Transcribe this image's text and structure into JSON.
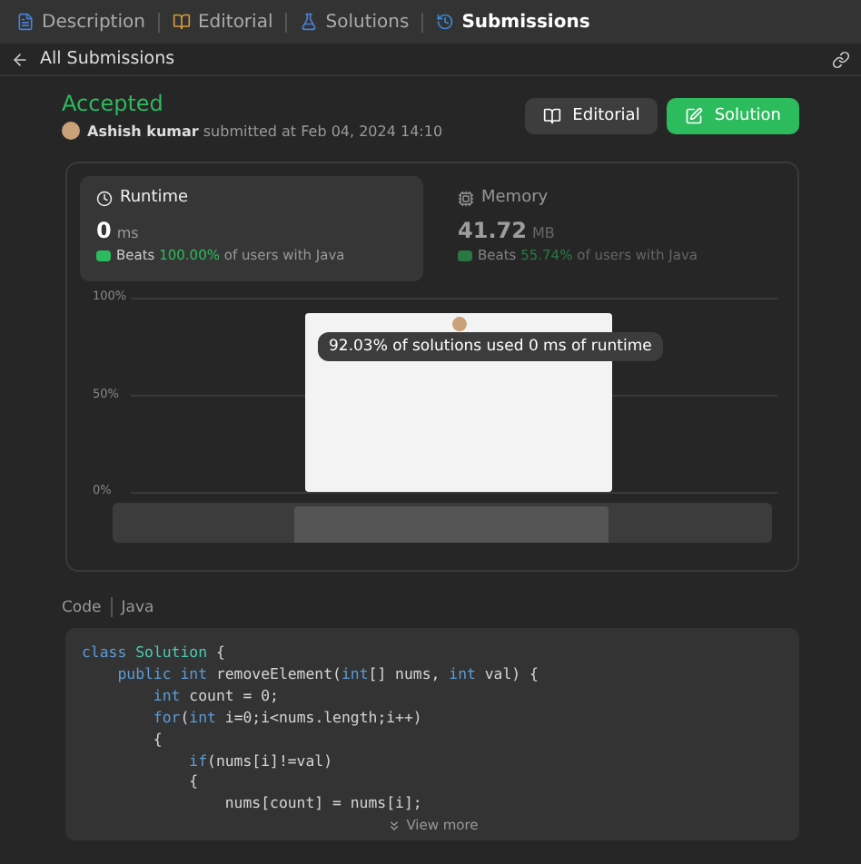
{
  "tabs": [
    {
      "label": "Description",
      "selected": false
    },
    {
      "label": "Editorial",
      "selected": false
    },
    {
      "label": "Solutions",
      "selected": false
    },
    {
      "label": "Submissions",
      "selected": true
    }
  ],
  "back_link": "All Submissions",
  "status": "Accepted",
  "author": "Ashish kumar",
  "submitted_text": "submitted at Feb 04, 2024 14:10",
  "buttons": [
    {
      "label": "Editorial",
      "kind": "secondary"
    },
    {
      "label": "Solution",
      "kind": "primary"
    }
  ],
  "stats": [
    {
      "title": "Runtime",
      "kind": "runtime",
      "value": "0",
      "unit": "ms",
      "beats_label": "Beats",
      "beats": "100.00%",
      "suffix": "of users with Java",
      "selected": true
    },
    {
      "title": "Memory",
      "kind": "memory",
      "value": "41.72",
      "unit": "MB",
      "beats_label": "Beats",
      "beats": "55.74%",
      "suffix": "of users with Java",
      "selected": false
    }
  ],
  "chart": {
    "tooltip": "92.03% of solutions used 0 ms of runtime",
    "chart_data": {
      "type": "bar",
      "values": [
        92
      ],
      "ylim": [
        0,
        100
      ],
      "yticks": [
        {
          "value": 0,
          "label": "0%"
        },
        {
          "value": 50,
          "label": "50%"
        },
        {
          "value": 100,
          "label": "100%"
        }
      ]
    }
  },
  "code_label": "Code",
  "language": "Java",
  "code_lines": [
    [
      {
        "text": "class",
        "kind": "keyword"
      },
      {
        "text": " Solution",
        "kind": "class"
      },
      {
        "text": " {"
      }
    ],
    [
      {
        "text": "    public",
        "kind": "keyword"
      },
      {
        "text": " int",
        "kind": "keyword"
      },
      {
        "text": " removeElement("
      },
      {
        "text": "int",
        "kind": "keyword"
      },
      {
        "text": "[] nums, "
      },
      {
        "text": "int",
        "kind": "keyword"
      },
      {
        "text": " val) {"
      }
    ],
    [
      {
        "text": "        int",
        "kind": "keyword"
      },
      {
        "text": " count = 0;"
      }
    ],
    [
      {
        "text": "        for",
        "kind": "keyword"
      },
      {
        "text": "("
      },
      {
        "text": "int",
        "kind": "keyword"
      },
      {
        "text": " i=0;i<nums.length;i++)"
      }
    ],
    [
      {
        "text": "        {"
      }
    ],
    [
      {
        "text": "            if",
        "kind": "keyword"
      },
      {
        "text": "(nums[i]!=val)"
      }
    ],
    [
      {
        "text": "            {"
      }
    ],
    [
      {
        "text": "                nums[count] = nums[i];"
      }
    ]
  ],
  "view_more": "View more"
}
